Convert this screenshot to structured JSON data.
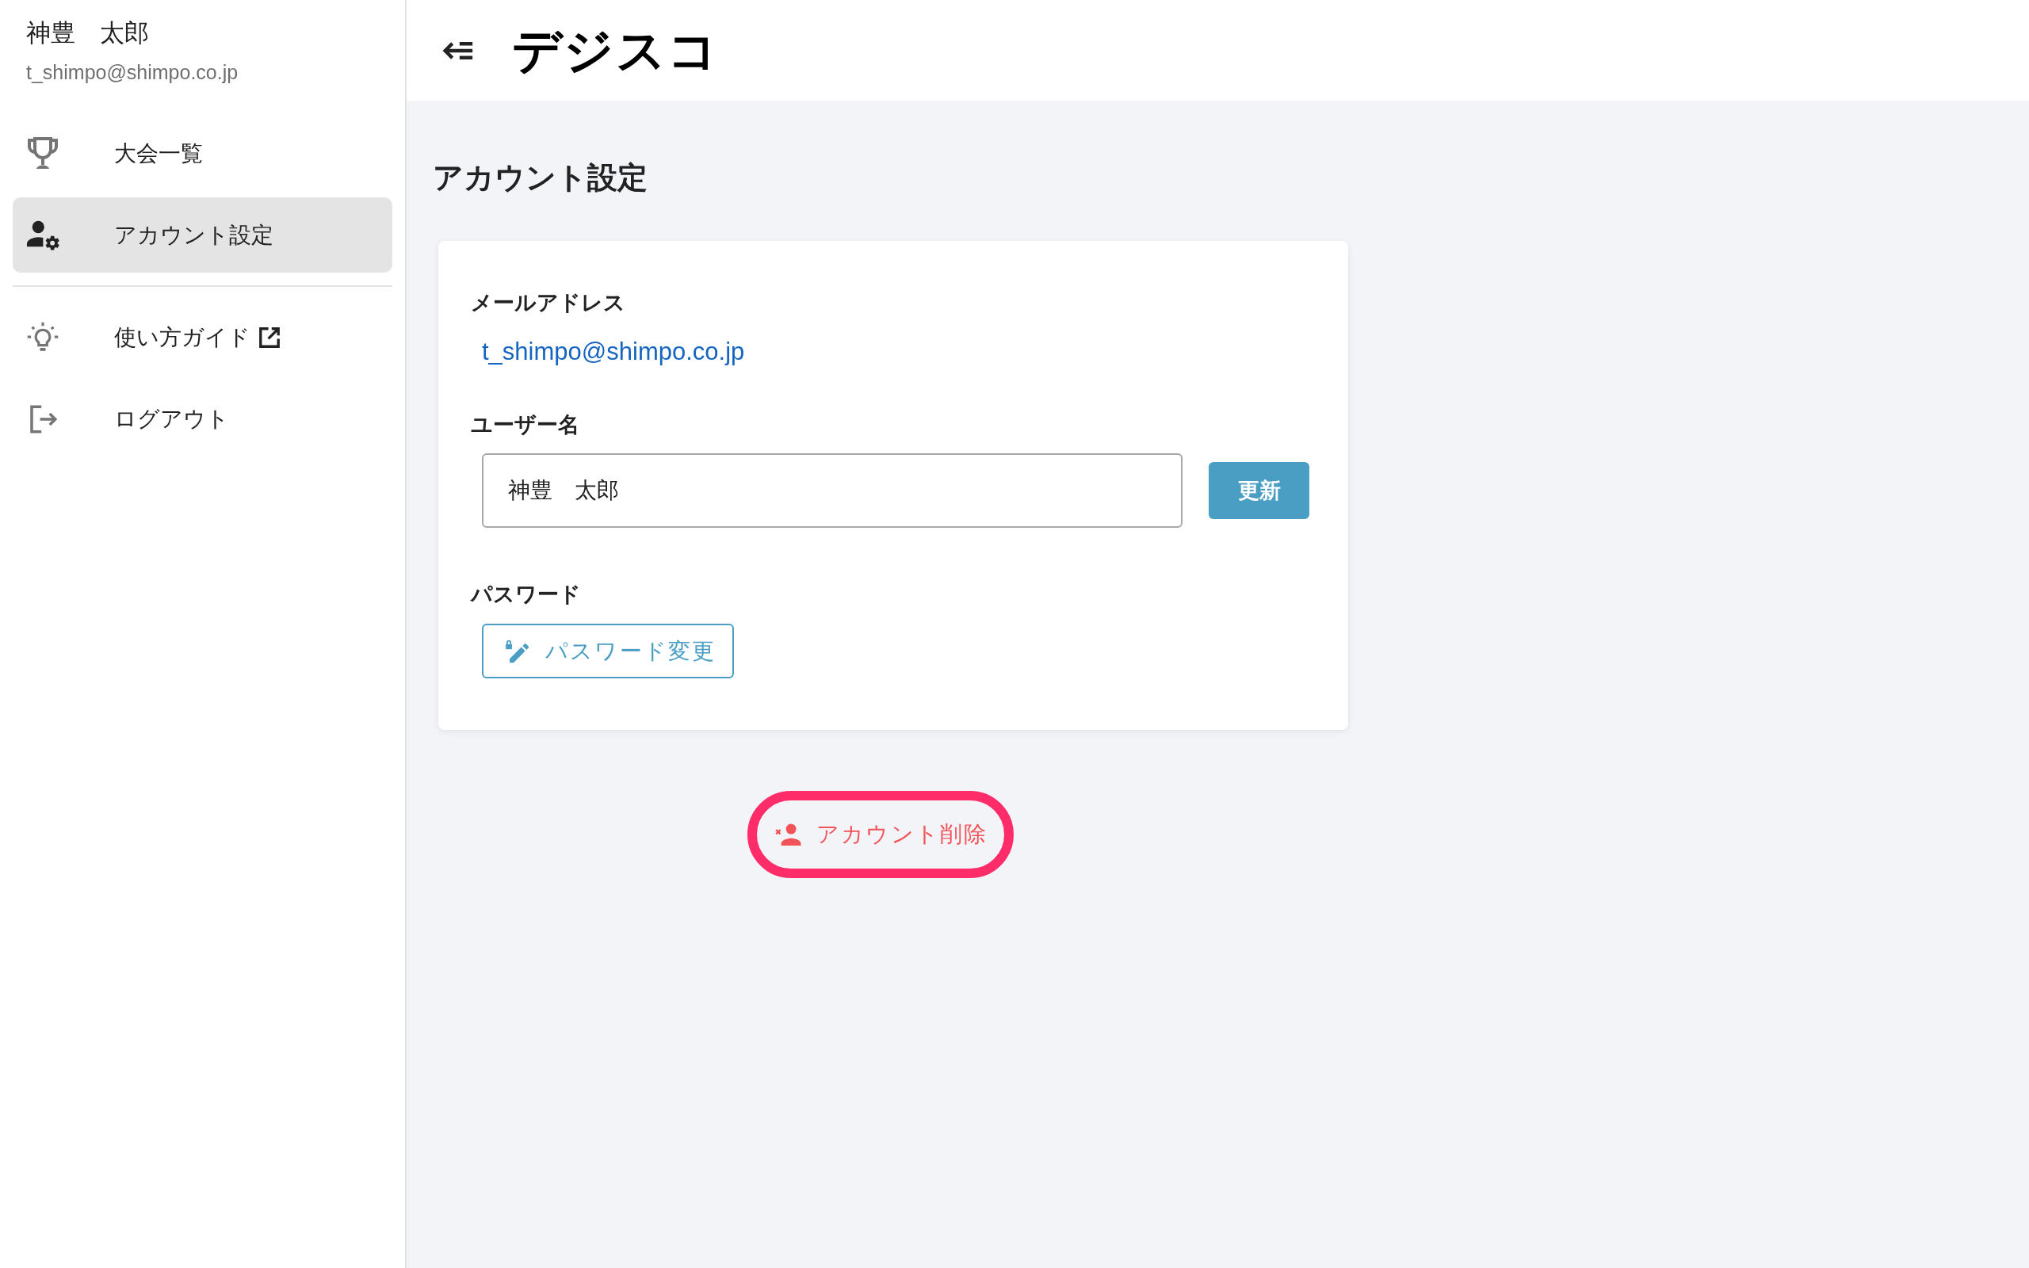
{
  "sidebar": {
    "user_name": "神豊　太郎",
    "user_email": "t_shimpo@shimpo.co.jp",
    "sections": [
      {
        "items": [
          {
            "label": "大会一覧",
            "selected": false,
            "kind": "internal"
          },
          {
            "label": "アカウント設定",
            "selected": true,
            "kind": "internal"
          }
        ]
      },
      {
        "items": [
          {
            "label": "使い方ガイド",
            "selected": false,
            "kind": "external"
          },
          {
            "label": "ログアウト",
            "selected": false,
            "kind": "internal"
          }
        ]
      }
    ]
  },
  "header": {
    "logo": "デジスコ"
  },
  "page": {
    "title": "アカウント設定"
  },
  "card": {
    "email_label": "メールアドレス",
    "email": "t_shimpo@shimpo.co.jp",
    "username_label": "ユーザー名",
    "username_value": "神豊　太郎",
    "update_button": "更新",
    "password_label": "パスワード",
    "password_button": "パスワード変更"
  },
  "delete_button": {
    "label": "アカウント削除",
    "highlighted": true
  }
}
